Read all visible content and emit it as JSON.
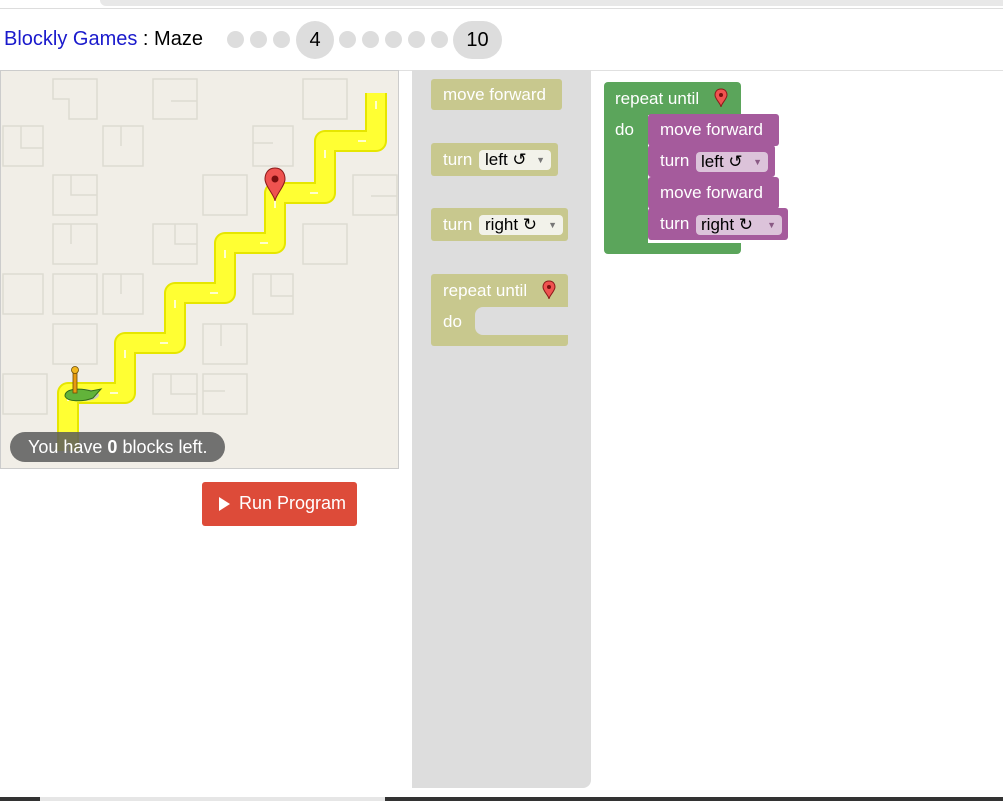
{
  "header": {
    "app_link": "Blockly Games",
    "separator": " : ",
    "game": "Maze",
    "current_level": "4",
    "last_level": "10"
  },
  "maze": {
    "capacity_prefix": "You have ",
    "capacity_count": "0",
    "capacity_suffix": " blocks left."
  },
  "run_button": {
    "label": "Run Program"
  },
  "toolbox": {
    "move_forward": "move forward",
    "turn": "turn",
    "left": "left ↺",
    "right": "right ↻",
    "repeat_until": "repeat until",
    "do": "do"
  },
  "workspace": {
    "repeat_until": "repeat until",
    "do": "do",
    "blocks": [
      {
        "label": "move forward"
      },
      {
        "label": "turn",
        "dir": "left ↺"
      },
      {
        "label": "move forward"
      },
      {
        "label": "turn",
        "dir": "right ↻"
      }
    ]
  },
  "colors": {
    "loop_green": "#5ba55b",
    "action_purple": "#a55b9c",
    "run_red": "#dd4b39",
    "path_yellow": "#ffff00",
    "link_blue": "#1a1acc"
  },
  "icons": [
    "marker-icon",
    "pegman-icon",
    "play-icon",
    "dropdown-arrow-icon"
  ]
}
